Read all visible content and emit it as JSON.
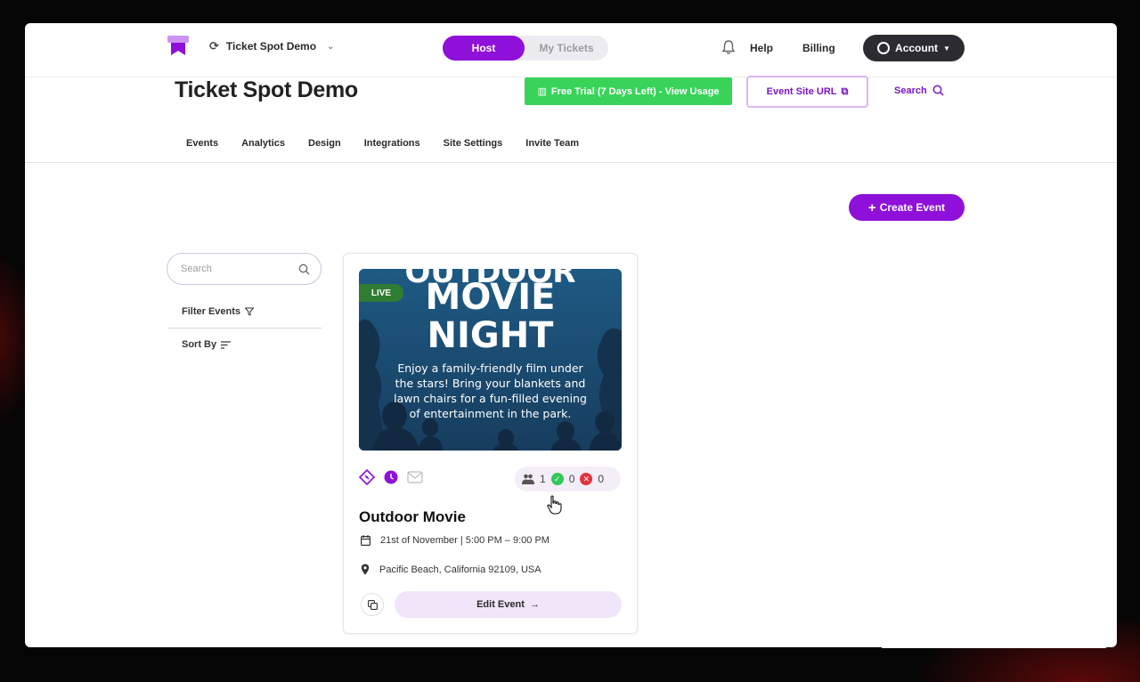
{
  "topbar": {
    "org_name": "Ticket Spot Demo",
    "toggle": {
      "host": "Host",
      "my_tickets": "My Tickets"
    },
    "help": "Help",
    "billing": "Billing",
    "account": "Account"
  },
  "header": {
    "title": "Ticket Spot Demo",
    "trial": "Free Trial (7 Days Left) - View Usage",
    "site_url": "Event Site URL",
    "search": "Search"
  },
  "nav": [
    "Events",
    "Analytics",
    "Design",
    "Integrations",
    "Site Settings",
    "Invite Team"
  ],
  "create_event": "Create Event",
  "sidebar": {
    "search_placeholder": "Search",
    "filter": "Filter Events",
    "sort": "Sort By"
  },
  "event": {
    "status": "LIVE",
    "poster": {
      "top": "OUTDOOR",
      "line1": "MOVIE",
      "line2": "NIGHT",
      "desc": "Enjoy a family-friendly film under the stars! Bring your blankets and lawn chairs for a fun-filled evening of entertainment in the park."
    },
    "stats": {
      "attendees": "1",
      "checked_in": "0",
      "cancelled": "0"
    },
    "title": "Outdoor Movie",
    "date": "21st of November | 5:00 PM – 9:00 PM",
    "location": "Pacific Beach, California 92109, USA",
    "edit": "Edit Event"
  },
  "colors": {
    "brand": "#8f10d8",
    "trial": "#39d35a",
    "live": "#2e7d32"
  }
}
